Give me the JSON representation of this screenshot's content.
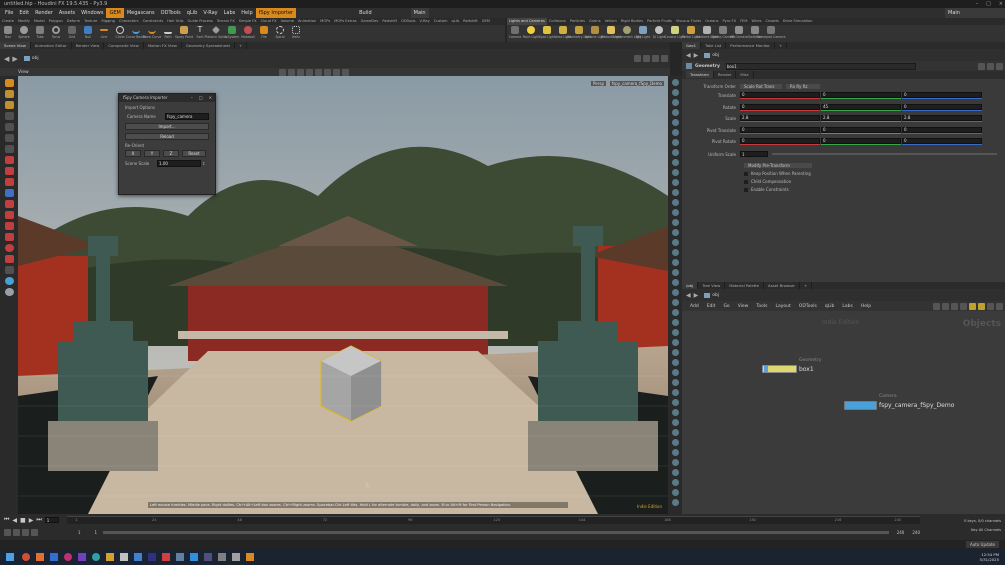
{
  "window": {
    "title": "untitled.hip - Houdini FX 19.5.435 - Py3.9"
  },
  "menu": [
    "File",
    "Edit",
    "Render",
    "Assets",
    "Windows",
    "GEM",
    "Megascans",
    "ODTools",
    "qLib",
    "V-Ray",
    "Labs",
    "Help",
    "fSpy Importer"
  ],
  "desktop": {
    "label": "Build",
    "name": "Main"
  },
  "shelf_tabs_left": [
    "Create",
    "Modify",
    "Model",
    "Polygon",
    "Deform",
    "Texture",
    "Rigging",
    "Characters",
    "Constraints",
    "Hair Utils",
    "Guide Process",
    "Terrain FX",
    "Simple FX",
    "Cloud FX",
    "Volume",
    "Animation",
    "MOPs",
    "MOPs Extras",
    "GameDev",
    "Redshift",
    "ODTools",
    "V-Ray",
    "Custom",
    "qLib",
    "Redshift",
    "GEM"
  ],
  "shelf_tabs_right": [
    "Lights and Cameras",
    "Collisions",
    "Particles",
    "Grains",
    "Vellum",
    "Rigid Bodies",
    "Particle Fluids",
    "Viscous Fluids",
    "Oceans",
    "Pyro FX",
    "FEM",
    "Wires",
    "Crowds",
    "Drive Simulation"
  ],
  "shelf_tools_left": [
    "Box",
    "Sphere",
    "Tube",
    "Torus",
    "Grid",
    "Null",
    "Line",
    "Circle",
    "Curve Bezier",
    "Draw Curve",
    "Path",
    "Spray Paint",
    "Font",
    "Platonic Solids",
    "L-System",
    "Metaball",
    "File",
    "Spiral",
    "Helix"
  ],
  "shelf_tools_right": [
    "Camera",
    "Point Light",
    "Spot Light",
    "Area Light",
    "Geometry Light",
    "Volume Light",
    "Distant Light",
    "Environment Light",
    "Sky Light",
    "GI Light",
    "Caustic Light",
    "Portal Light",
    "Ambient Light",
    "Stereo Camera",
    "VR Camera",
    "Switcher",
    "Gamepad Camera"
  ],
  "viewport_tabs": [
    "Scene View",
    "Animation Editor",
    "Render View",
    "Composite View",
    "Motion FX View",
    "Geometry Spreadsheet"
  ],
  "viewport_path": "obj",
  "viewport_label": "View",
  "viewport_badges": {
    "persp": "Persp",
    "camera": "fspy_camera_fSpy_Demo"
  },
  "viewport_hint": "Left mouse tumbles. Middle pans. Right dollies. Ctrl+Alt+Left box zooms. Ctrl+Right zooms. Spacebar-Ctrl-Left tilts. Hold L for alternate tumble, dolly, and zoom.   M or Alt+M for First Person Navigation.",
  "indie_badge": "Indie Edition",
  "dialog": {
    "title": "fSpy Camera Importer",
    "section": "Import Options",
    "camera_name_label": "Camera Name",
    "camera_name_value": "fspy_camera",
    "import_label": "Import...",
    "reload_label": "Reload",
    "reorient_label": "Re-Orient",
    "axes": [
      "X",
      "Y",
      "Z"
    ],
    "reset_label": "Reset",
    "scene_scale_label": "Scene Scale",
    "scene_scale_value": "1.00"
  },
  "params": {
    "tabs": [
      "Geo1",
      "Take List",
      "Performance Monitor"
    ],
    "path": "obj",
    "node_type": "Geometry",
    "node_name": "box1",
    "sub_tabs": [
      "Transform",
      "Render",
      "Misc"
    ],
    "transform_order_label": "Transform Order",
    "transform_order_value": "Scale Rot Trans",
    "rot_order_value": "Rx Ry Rz",
    "rows": [
      {
        "label": "Translate",
        "values": [
          "0",
          "0",
          "0"
        ]
      },
      {
        "label": "Rotate",
        "values": [
          "0",
          "45",
          "0"
        ]
      },
      {
        "label": "Scale",
        "values": [
          "2.8",
          "2.8",
          "2.8"
        ]
      },
      {
        "label": "Pivot Translate",
        "values": [
          "0",
          "0",
          "0"
        ]
      },
      {
        "label": "Pivot Rotate",
        "values": [
          "0",
          "0",
          "0"
        ]
      }
    ],
    "uniform_scale_label": "Uniform Scale",
    "uniform_scale_value": "1",
    "modify_pre_label": "Modify Pre-Transform",
    "checks": [
      "Keep Position When Parenting",
      "Child Compensation",
      "Enable Constraints"
    ]
  },
  "network": {
    "tabs": [
      "/obj",
      "Tree View",
      "Material Palette",
      "Asset Browser"
    ],
    "path": "obj",
    "menu": [
      "Add",
      "Edit",
      "Go",
      "View",
      "Tools",
      "Layout",
      "ODTools",
      "qLib",
      "Labs",
      "Help"
    ],
    "watermark_edition": "Indie Edition",
    "watermark_context": "Objects",
    "nodes": [
      {
        "type": "Geometry",
        "name": "box1"
      },
      {
        "type": "Camera",
        "name": "fspy_camera_fSpy_Demo"
      }
    ]
  },
  "playbar": {
    "frame": "1",
    "start": "1",
    "start2": "1",
    "end": "240",
    "end2": "240",
    "ticks": [
      "1",
      "24",
      "48",
      "72",
      "96",
      "120",
      "144",
      "168",
      "192",
      "216",
      "240"
    ]
  },
  "right_status": {
    "keys": "0 keys, 0/0 channels",
    "key_all": "Key All Channels",
    "auto_update": "Auto Update"
  },
  "taskbar": {
    "time": "12:54 PM",
    "date": "5/31/2025"
  },
  "colors": {
    "accent": "#d98a1e",
    "red_axis": "#c63a3a",
    "green_axis": "#3aa64a",
    "blue_axis": "#3a6ac6"
  }
}
